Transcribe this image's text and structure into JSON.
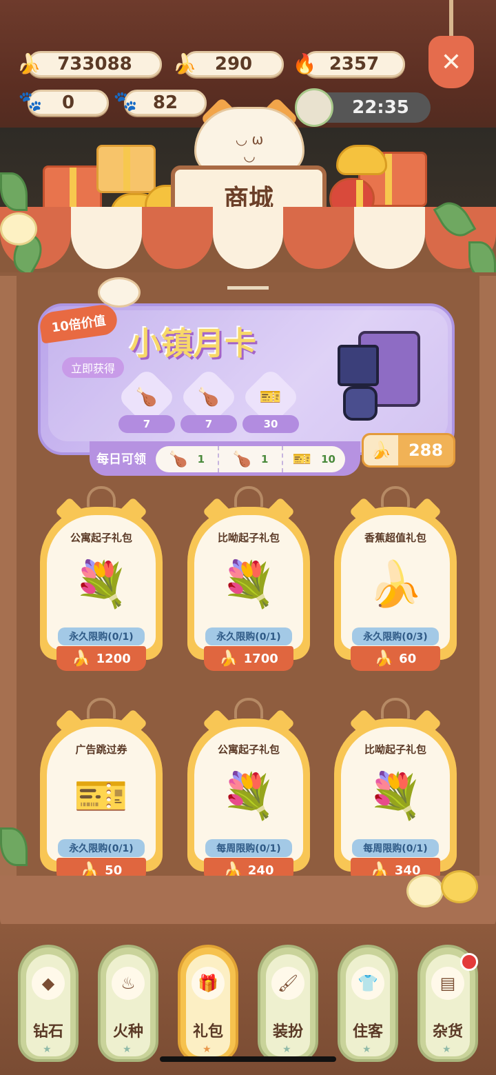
{
  "resources": {
    "banana": "733088",
    "blue_banana": "290",
    "fire": "2357",
    "paw_white": "0",
    "paw_orange": "82",
    "time": "22:35"
  },
  "shop": {
    "title": "商城"
  },
  "month_card": {
    "badge": "10倍价值",
    "title": "小镇月卡",
    "claim_label": "立即获得",
    "rewards": [
      {
        "icon": "paw-white-icon",
        "count": "7"
      },
      {
        "icon": "paw-orange-icon",
        "count": "7"
      },
      {
        "icon": "ad-ticket-icon",
        "count": "30"
      }
    ],
    "daily_label": "每日可领",
    "daily": [
      {
        "icon": "paw-white-icon",
        "count": "1"
      },
      {
        "icon": "paw-orange-icon",
        "count": "1"
      },
      {
        "icon": "ad-ticket-icon",
        "count": "10"
      }
    ],
    "price": "288"
  },
  "items": [
    {
      "name": "公寓起子礼包",
      "limit": "永久限购(0/1)",
      "price": "1200",
      "icon": "paw-bouquet-orange-icon"
    },
    {
      "name": "比呦起子礼包",
      "limit": "永久限购(0/1)",
      "price": "1700",
      "icon": "paw-bouquet-white-icon"
    },
    {
      "name": "香蕉超值礼包",
      "limit": "永久限购(0/3)",
      "price": "60",
      "icon": "banana-chest-icon"
    },
    {
      "name": "广告跳过券",
      "limit": "永久限购(0/1)",
      "price": "50",
      "icon": "ad-ticket-pack-icon"
    },
    {
      "name": "公寓起子礼包",
      "limit": "每周限购(0/1)",
      "price": "240",
      "icon": "paw-bouquet-orange-icon"
    },
    {
      "name": "比呦起子礼包",
      "limit": "每周限购(0/1)",
      "price": "340",
      "icon": "paw-bouquet-white-icon"
    }
  ],
  "nav": [
    {
      "label": "钻石",
      "icon": "diamond-icon"
    },
    {
      "label": "火种",
      "icon": "flame-icon"
    },
    {
      "label": "礼包",
      "icon": "gift-icon"
    },
    {
      "label": "装扮",
      "icon": "brush-icon"
    },
    {
      "label": "住客",
      "icon": "shirt-icon"
    },
    {
      "label": "杂货",
      "icon": "goods-icon"
    }
  ],
  "nav_active_index": 2
}
